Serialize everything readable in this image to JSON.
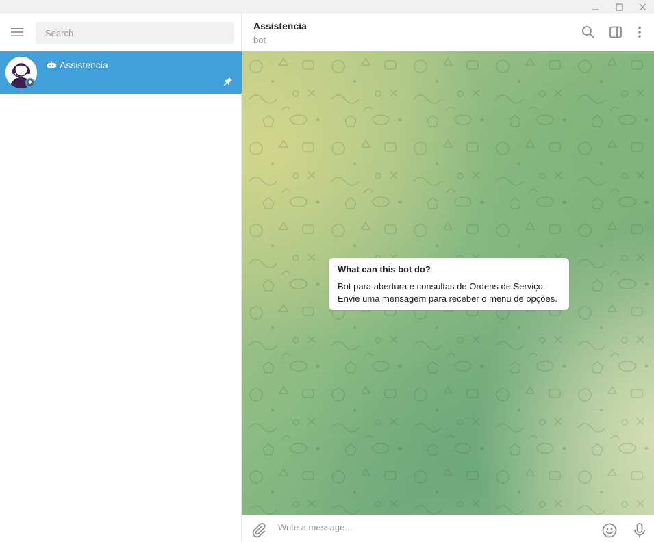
{
  "window": {
    "buttons": [
      {
        "name": "minimize-icon"
      },
      {
        "name": "maximize-icon"
      },
      {
        "name": "close-icon"
      }
    ]
  },
  "sidebar": {
    "menu_icon": "hamburger-menu-icon",
    "search_placeholder": "Search",
    "chats": [
      {
        "name": "Assistencia",
        "avatar_icon": "support-agent-avatar",
        "is_bot": true,
        "pinned": true,
        "selected": true
      }
    ]
  },
  "chat": {
    "title": "Assistencia",
    "status": "bot",
    "header_icons": [
      "search-icon",
      "sidebar-toggle-icon",
      "more-vertical-icon"
    ],
    "bot_info": {
      "title": "What can this bot do?",
      "lines": [
        "Bot para abertura e consultas de Ordens de Serviço.",
        "Envie uma mensagem para receber o menu de opções."
      ]
    },
    "composer": {
      "placeholder": "Write a message...",
      "icons": [
        "attach-icon",
        "emoji-icon",
        "microphone-icon"
      ]
    }
  },
  "colors": {
    "accent": "#419fd9",
    "title_bar": "#f1f1f1",
    "search_bg": "#f1f1f1",
    "muted_text": "#999999"
  }
}
